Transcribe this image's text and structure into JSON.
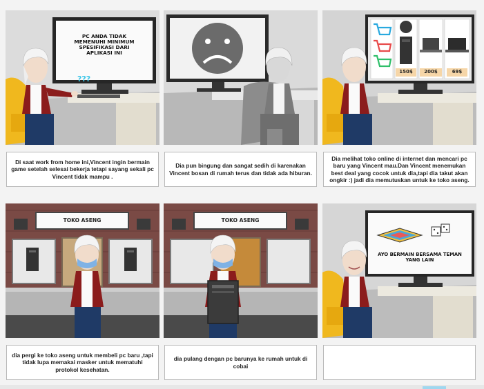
{
  "panels": [
    {
      "screen_text": [
        "PC ANDA TIDAK",
        "MEMENUHI MINIMUM",
        "SPESIFIKASI DARI",
        "APLIKASI INI"
      ],
      "thought": "???",
      "caption": "Di saat work from home ini,Vincent ingin bermain game setelah selesai bekerja tetapi sayang sekali pc Vincent tidak mampu ."
    },
    {
      "caption": "Dia pun bingung dan sangat sedih di karenakan Vincent bosan di rumah terus dan tidak ada hiburan."
    },
    {
      "prices": [
        "150$",
        "200$",
        "69$"
      ],
      "caption": "Dia melihat toko online di internet dan mencari pc baru yang Vincent mau.Dan Vincent menemukan best deal yang cocok untuk dia,tapi dia takut akan ongkir :) jadi dia memutuskan untuk ke toko aseng."
    },
    {
      "store_sign": "TOKO ASENG",
      "caption": "dia pergi ke toko aseng untuk membeli pc baru ,tapi tidak lupa memakai masker untuk mematuhi protokol kesehatan."
    },
    {
      "store_sign": "TOKO ASENG",
      "caption": "dia pulang dengan pc barunya ke rumah untuk di cobai"
    },
    {
      "screen_text": [
        "AYO BERMAIN BERSAMA TEMAN",
        "YANG LAIN"
      ],
      "caption": ""
    }
  ],
  "colors": {
    "jacket": "#8b1c1c",
    "wall_brick": "#7a4a45",
    "desk": "#e9e6dc",
    "chair": "#f0b81e"
  }
}
